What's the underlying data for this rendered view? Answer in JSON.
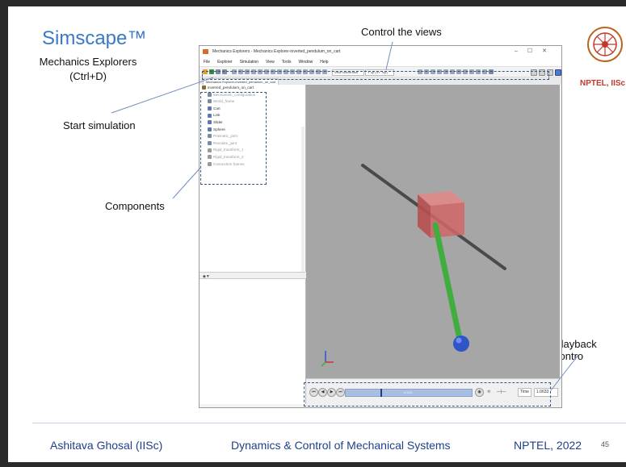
{
  "slide": {
    "title": "Simscape™",
    "subtitle_line1": "Mechanics Explorers",
    "subtitle_line2": "(Ctrl+D)",
    "annotations": {
      "control_views": "Control the views",
      "start_simulation": "Start simulation",
      "components": "Components",
      "playback_controls": "Playback contro"
    },
    "logo_text": "NPTEL, IISc",
    "footer": {
      "author": "Ashitava Ghosal (IISc)",
      "course": "Dynamics & Control of Mechanical Systems",
      "org": "NPTEL, 2022",
      "page": "45"
    }
  },
  "app": {
    "window_title": "Mechanics Explorers - Mechanics Explorer-inverted_pendulum_on_cart",
    "menu": [
      "File",
      "Explorer",
      "Simulation",
      "View",
      "Tools",
      "Window",
      "Help"
    ],
    "toolbar": {
      "view_convention": "View convention",
      "view_select": "Y up (XY Top)"
    },
    "tab_label": "Mechanics Explorer-inverted_pendulum_on_cart",
    "tree_items": [
      {
        "label": "inverted_pendulum_on_cart",
        "dim": false
      },
      {
        "label": "Mechanism_configuration",
        "dim": true
      },
      {
        "label": "World_frame",
        "dim": true
      },
      {
        "label": "Cart",
        "dim": false
      },
      {
        "label": "Link",
        "dim": false
      },
      {
        "label": "Slider",
        "dim": false
      },
      {
        "label": "Sphere",
        "dim": false
      },
      {
        "label": "Prismatic_joint",
        "dim": true
      },
      {
        "label": "Revolute_joint",
        "dim": true
      },
      {
        "label": "Rigid_transform_1",
        "dim": true
      },
      {
        "label": "Rigid_transform_2",
        "dim": true
      },
      {
        "label": "Connection frames",
        "dim": true
      }
    ],
    "playback": {
      "time_label": "Time",
      "time_value": "1.0633",
      "track_label": "0.163"
    }
  },
  "colors": {
    "title_blue": "#3a78c8",
    "footer_blue": "#1f3f8a",
    "annotation_dash": "#34558a",
    "viewport_bg": "#a6a6a6",
    "cart_red": "#d66666",
    "link_green": "#3fae3f",
    "bob_blue": "#2f55c8",
    "rail_gray": "#555555"
  },
  "icons": [
    "nptel-logo-icon",
    "app-icon",
    "tree-node-icon",
    "triad-axis-icon",
    "play-icon",
    "step-forward-icon",
    "step-back-icon",
    "rewind-icon"
  ]
}
